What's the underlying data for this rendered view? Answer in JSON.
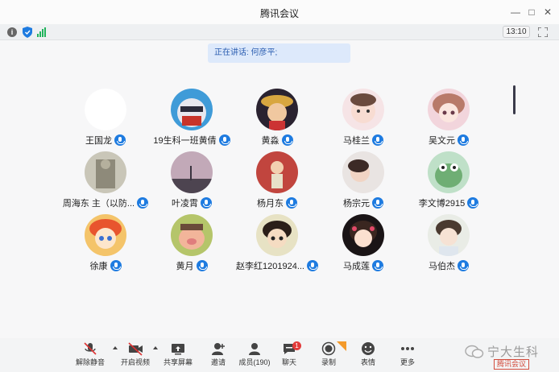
{
  "window": {
    "title": "腾讯会议"
  },
  "infobar": {
    "timer": "13:10"
  },
  "speaking": {
    "label": "正在讲话: 何彦平;"
  },
  "participants": [
    {
      "name": "王国龙"
    },
    {
      "name": "19生科一班黄倩"
    },
    {
      "name": "黄淼"
    },
    {
      "name": "马桂兰"
    },
    {
      "name": "吴文元"
    },
    {
      "name": "周海东  主（以防..."
    },
    {
      "name": "叶凌霄"
    },
    {
      "name": "杨月东"
    },
    {
      "name": "杨宗元"
    },
    {
      "name": "李文博2915"
    },
    {
      "name": "徐康"
    },
    {
      "name": "黄月"
    },
    {
      "name": "赵李红1201924..."
    },
    {
      "name": "马成莲"
    },
    {
      "name": "马伯杰"
    }
  ],
  "toolbar": {
    "unmute": "解除静音",
    "video": "开启视频",
    "share": "共享屏幕",
    "invite": "邀请",
    "members": "成员(190)",
    "chat": "聊天",
    "chat_badge": "1",
    "record": "录制",
    "reactions": "表情",
    "more": "更多"
  },
  "watermark": {
    "text": "宁大生科",
    "sub": "腾讯会议"
  }
}
